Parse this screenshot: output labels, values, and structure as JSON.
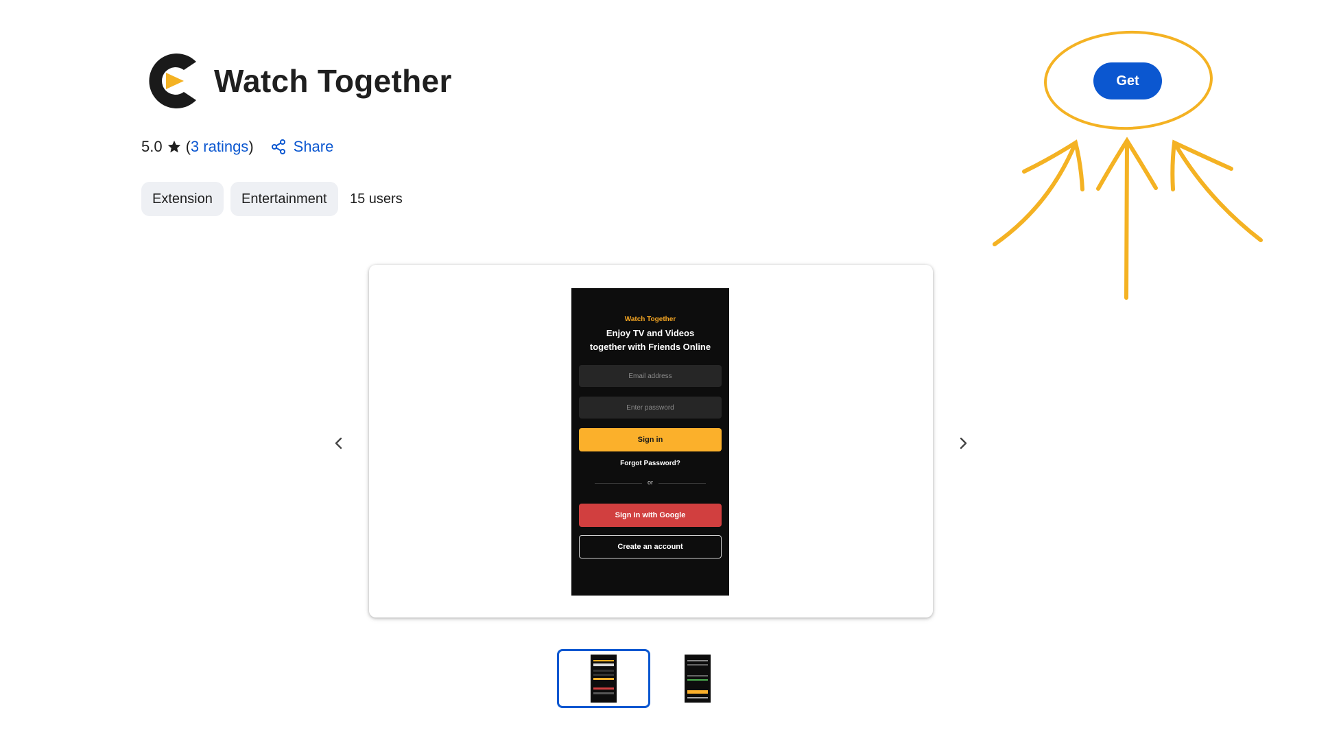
{
  "header": {
    "title": "Watch Together",
    "logo_icon": "watch-together-logo",
    "rating_value": "5.0",
    "ratings_link_open": "(",
    "ratings_link_text": "3 ratings",
    "ratings_link_close": ")",
    "share_label": "Share",
    "get_label": "Get"
  },
  "chips": {
    "type": "Extension",
    "category": "Entertainment",
    "users": "15 users"
  },
  "screenshot": {
    "brand": "Watch Together",
    "headline_line1": "Enjoy TV and Videos",
    "headline_line2": "together with Friends Online",
    "email_placeholder": "Email address",
    "password_placeholder": "Enter password",
    "signin_label": "Sign in",
    "forgot_label": "Forgot Password?",
    "or_label": "or",
    "google_label": "Sign in with Google",
    "create_label": "Create an account"
  },
  "colors": {
    "accent_blue": "#0b57d0",
    "annotation_yellow": "#f4b223",
    "signin_yellow": "#fbb02b",
    "google_red": "#d13f3f"
  },
  "icons": {
    "star": "star-icon",
    "share": "share-icon",
    "prev": "chevron-left-icon",
    "next": "chevron-right-icon"
  }
}
